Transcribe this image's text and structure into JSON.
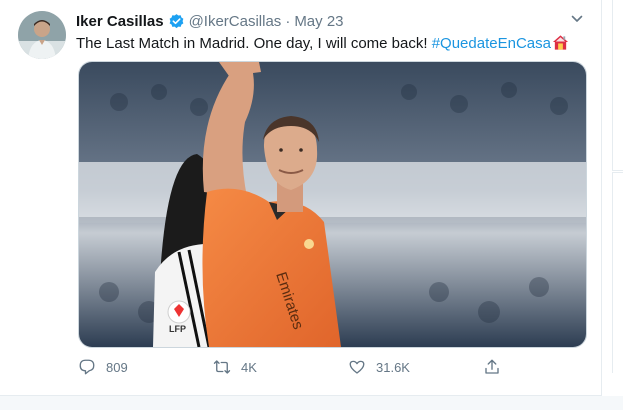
{
  "tweet": {
    "author_name": "Iker Casillas",
    "handle": "@IkerCasillas",
    "separator": "·",
    "date": "May 23",
    "text": "The Last Match in Madrid. One day, I will come back! ",
    "hashtag": "#QuedateEnCasa",
    "media": {
      "sleeve_badge": "LFP",
      "shirt_text": "Emirates"
    },
    "actions": {
      "reply_count": "809",
      "retweet_count": "4K",
      "like_count": "31.6K"
    }
  },
  "colors": {
    "link": "#1b95e0",
    "verified": "#1da1f2",
    "muted": "#657786",
    "jersey": "#f07a3a"
  },
  "icons": [
    "verified-badge-icon",
    "chevron-down-icon",
    "house-emoji-icon",
    "reply-icon",
    "retweet-icon",
    "like-icon",
    "share-icon"
  ]
}
